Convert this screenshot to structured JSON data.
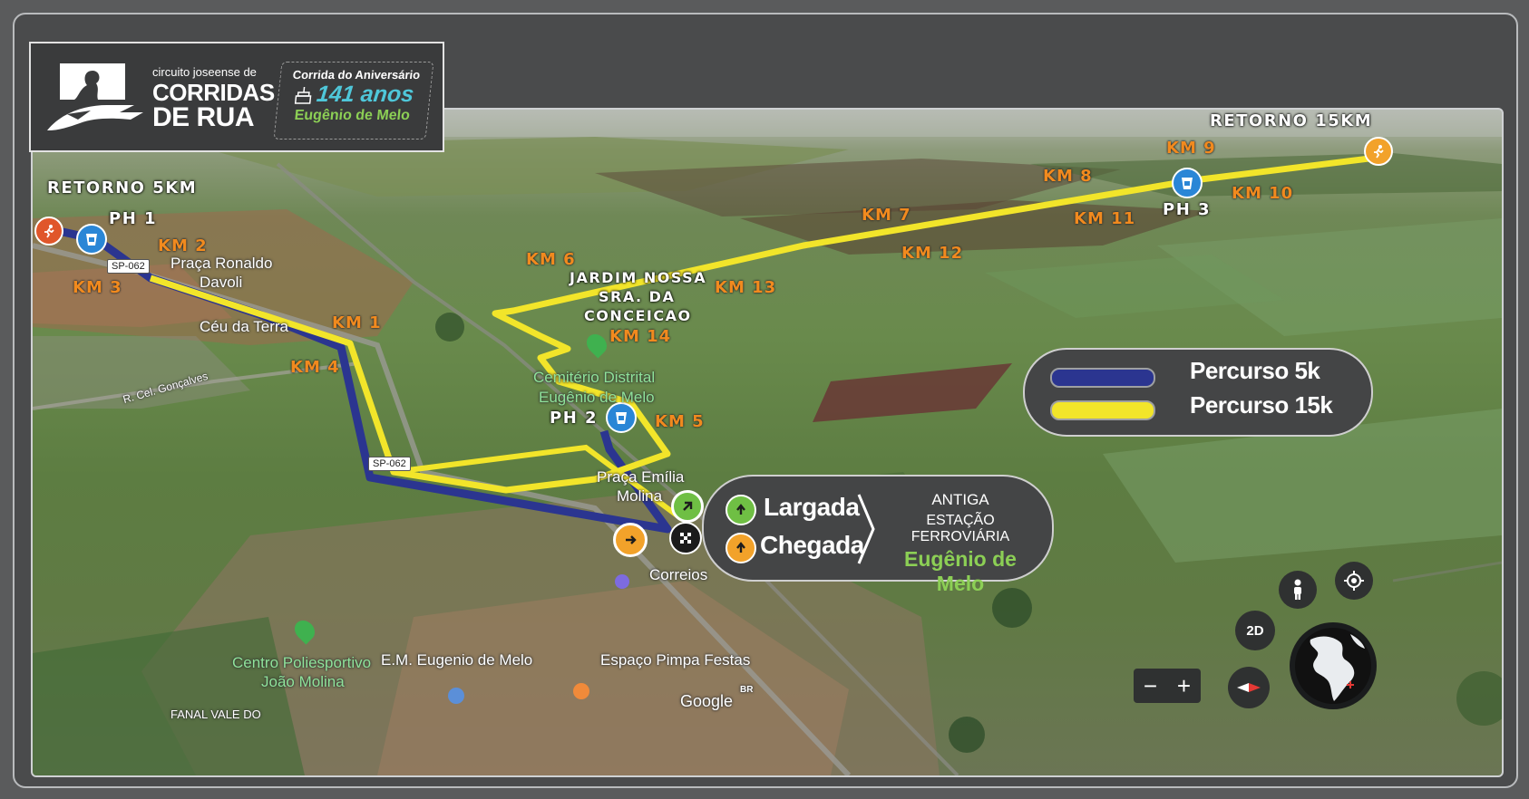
{
  "logo": {
    "small_line": "circuito joseense de",
    "line1": "CORRIDAS",
    "line2": "DE RUA",
    "badge_title": "Corrida do Aniversário",
    "badge_years": "141 anos",
    "badge_place": "Eugênio de Melo",
    "cake_icon": "cake-icon",
    "runner_icon": "runner-logo-icon"
  },
  "map_labels": {
    "retorno_5km": "RETORNO 5KM",
    "retorno_15km": "RETORNO 15KM",
    "ph1": "PH 1",
    "ph2": "PH 2",
    "ph3": "PH 3",
    "km1": "KM 1",
    "km2": "KM 2",
    "km3": "KM 3",
    "km4": "KM 4",
    "km5": "KM 5",
    "km6": "KM 6",
    "km7": "KM 7",
    "km8": "KM 8",
    "km9": "KM 9",
    "km10": "KM 10",
    "km11": "KM 11",
    "km12": "KM 12",
    "km13": "KM 13",
    "km14": "KM 14",
    "jardim_1": "JARDIM NOSSA",
    "jardim_2": "SRA. DA",
    "jardim_3": "CONCEICAO"
  },
  "places": {
    "praca_ronaldo_1": "Praça Ronaldo",
    "praca_ronaldo_2": "Davoli",
    "ceu_da_terra": "Céu da Terra",
    "r_cel": "R. Cel. Gonçalves",
    "cemiterio_1": "Cemitério Distrital",
    "cemiterio_2": "Eugênio de Melo",
    "praca_emilia_1": "Praça Emília",
    "praca_emilia_2": "Molina",
    "correios": "Correios",
    "centro_1": "Centro Poliesportivo",
    "centro_2": "João Molina",
    "em": "E.M. Eugenio de Melo",
    "espaco": "Espaço Pimpa Festas",
    "fanal": "FANAL VALE DO",
    "google": "Google",
    "br": "BR",
    "sp062_a": "SP-062",
    "sp062_b": "SP-062"
  },
  "legend": {
    "route_5k": "Percurso 5k",
    "route_15k": "Percurso 15k",
    "color_5k": "#2b3590",
    "color_15k": "#f2e52a"
  },
  "start_finish": {
    "largada": "Largada",
    "chegada": "Chegada",
    "station_1": "ANTIGA",
    "station_2": "ESTAÇÃO FERROVIÁRIA",
    "station_3": "Eugênio de Melo"
  },
  "controls": {
    "mode_2d": "2D",
    "zoom_out": "−",
    "zoom_in": "+",
    "pegman_icon": "pegman-icon",
    "locate_icon": "my-location-icon",
    "compass_icon": "compass-icon",
    "globe_icon": "globe-icon"
  }
}
